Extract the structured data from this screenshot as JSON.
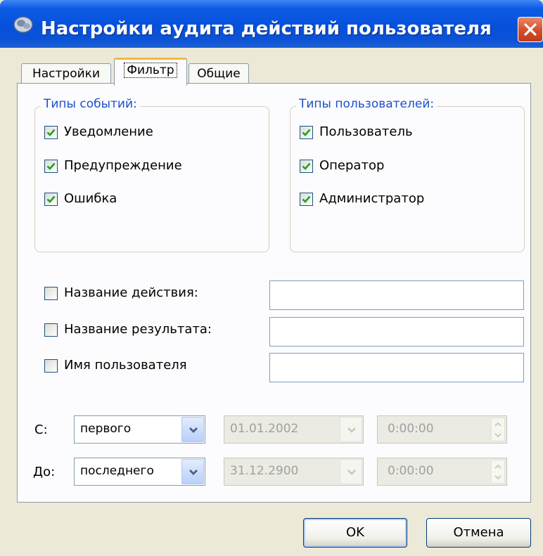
{
  "window": {
    "title": "Настройки аудита действий пользователя",
    "icon": "gear-app-icon",
    "close_icon": "close-icon"
  },
  "tabs": [
    {
      "label": "Настройки",
      "active": false
    },
    {
      "label": "Фильтр",
      "active": true
    },
    {
      "label": "Общие",
      "active": false
    }
  ],
  "event_types": {
    "title": "Типы событий:",
    "items": [
      {
        "label": "Уведомление",
        "checked": true
      },
      {
        "label": "Предупреждение",
        "checked": true
      },
      {
        "label": "Ошибка",
        "checked": true
      }
    ]
  },
  "user_types": {
    "title": "Типы пользователей:",
    "items": [
      {
        "label": "Пользователь",
        "checked": true
      },
      {
        "label": "Оператор",
        "checked": true
      },
      {
        "label": "Администратор",
        "checked": true
      }
    ]
  },
  "filters": [
    {
      "label": "Название действия:",
      "checked": false,
      "value": ""
    },
    {
      "label": "Название результата:",
      "checked": false,
      "value": ""
    },
    {
      "label": "Имя пользователя",
      "checked": false,
      "value": ""
    }
  ],
  "range": {
    "from": {
      "label": "С:",
      "mode": "первого",
      "date": "01.01.2002",
      "time": "0:00:00"
    },
    "to": {
      "label": "До:",
      "mode": "последнего",
      "date": "31.12.2900",
      "time": "0:00:00"
    }
  },
  "buttons": {
    "ok": "OK",
    "cancel": "Отмена"
  },
  "colors": {
    "titlebar": "#0a52d6",
    "group_title": "#1e50c8",
    "active_tab_highlight": "#f4b93f",
    "check": "#21a121"
  }
}
